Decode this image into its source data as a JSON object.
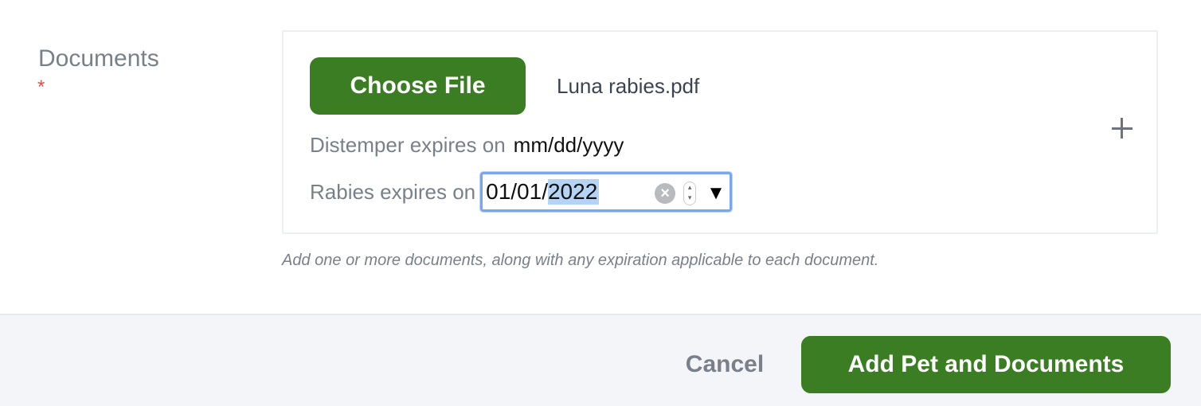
{
  "documents_field": {
    "label": "Documents",
    "required_marker": "*"
  },
  "upload": {
    "choose_file_label": "Choose File",
    "file_name": "Luna rabies.pdf",
    "add_icon": "plus-icon"
  },
  "expirations": {
    "distemper_label": "Distemper expires on",
    "distemper_value": "mm/dd/yyyy",
    "rabies_label": "Rabies expires on",
    "rabies_value_prefix": "01/01/",
    "rabies_value_selected": "2022"
  },
  "help_text": "Add one or more documents, along with any expiration applicable to each document.",
  "footer": {
    "cancel_label": "Cancel",
    "submit_label": "Add Pet and Documents"
  },
  "colors": {
    "primary": "#3a7d22",
    "required": "#d9534f",
    "focus": "#7aa6ef",
    "footer_bg": "#f4f5f9"
  }
}
